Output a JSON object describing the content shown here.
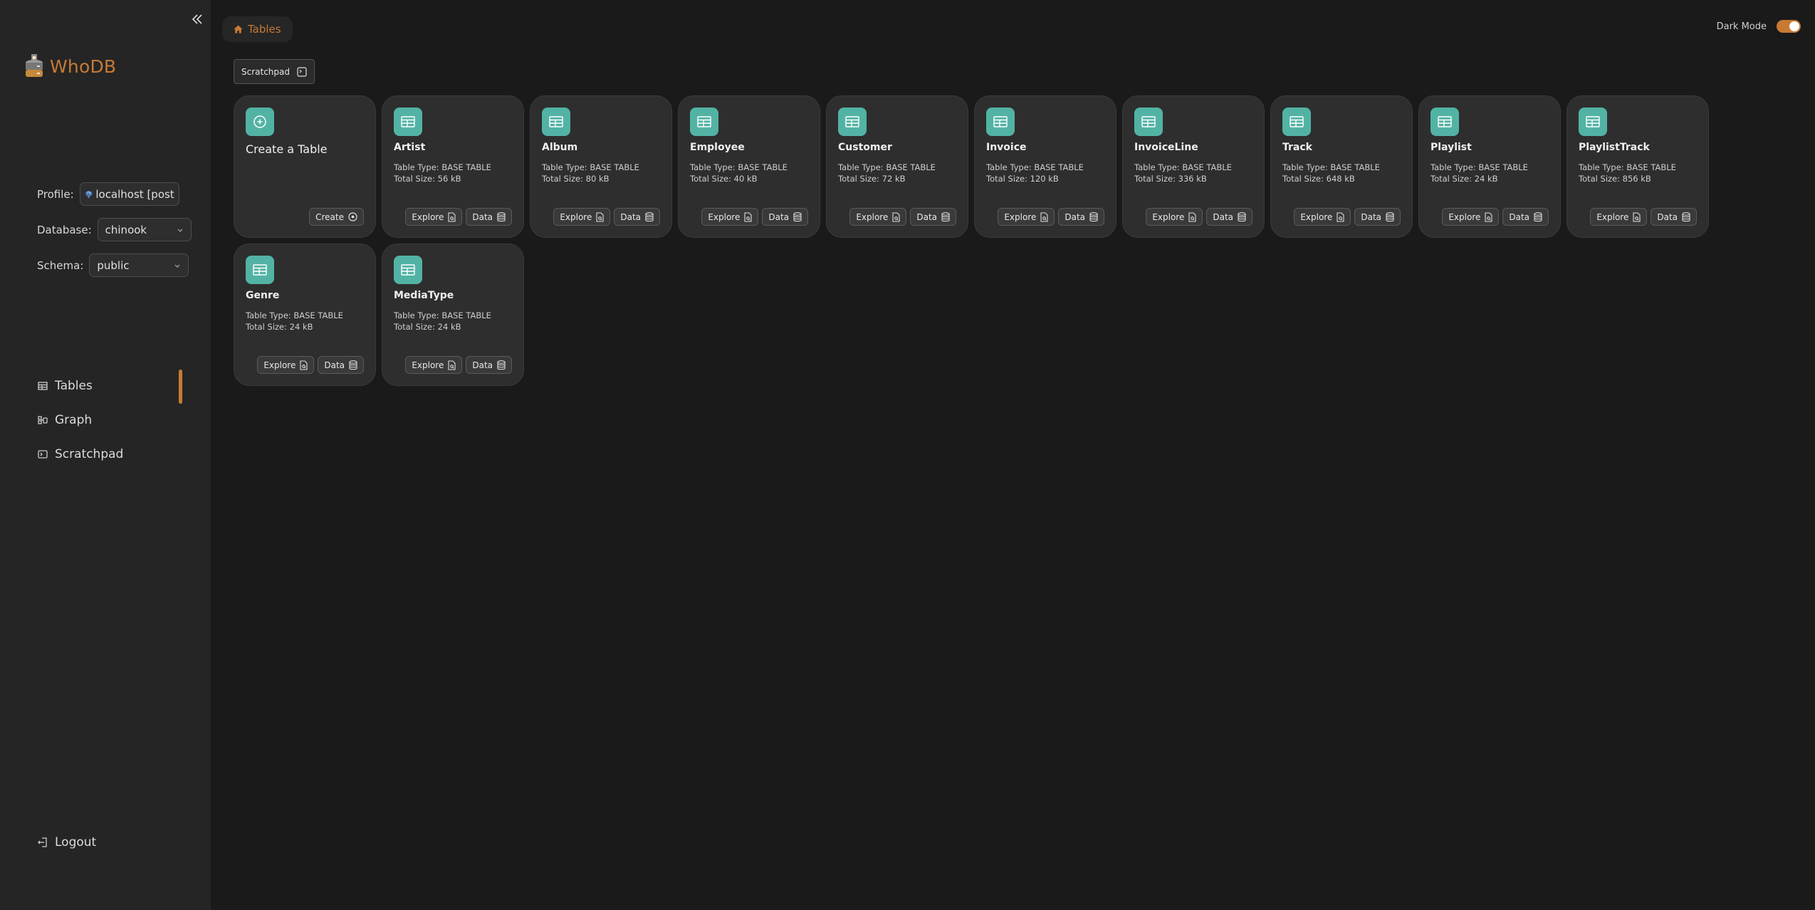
{
  "app": {
    "name": "WhoDB",
    "accent": "#c87a34",
    "tile_color": "#52b3a4"
  },
  "sidebar": {
    "profile": {
      "label": "Profile:",
      "value": "localhost [post"
    },
    "database": {
      "label": "Database:",
      "value": "chinook"
    },
    "schema": {
      "label": "Schema:",
      "value": "public"
    },
    "nav": [
      {
        "label": "Tables",
        "icon": "table-icon",
        "active": true
      },
      {
        "label": "Graph",
        "icon": "graph-icon",
        "active": false
      },
      {
        "label": "Scratchpad",
        "icon": "terminal-icon",
        "active": false
      }
    ],
    "logout_label": "Logout"
  },
  "header": {
    "breadcrumb": "Tables",
    "dark_mode_label": "Dark Mode",
    "dark_mode_on": true,
    "scratchpad_label": "Scratchpad"
  },
  "create_card": {
    "title": "Create a Table",
    "button_label": "Create"
  },
  "tables": [
    {
      "name": "Artist",
      "type": "Table Type: BASE TABLE",
      "size": "Total Size: 56 kB"
    },
    {
      "name": "Album",
      "type": "Table Type: BASE TABLE",
      "size": "Total Size: 80 kB"
    },
    {
      "name": "Employee",
      "type": "Table Type: BASE TABLE",
      "size": "Total Size: 40 kB"
    },
    {
      "name": "Customer",
      "type": "Table Type: BASE TABLE",
      "size": "Total Size: 72 kB"
    },
    {
      "name": "Invoice",
      "type": "Table Type: BASE TABLE",
      "size": "Total Size: 120 kB"
    },
    {
      "name": "InvoiceLine",
      "type": "Table Type: BASE TABLE",
      "size": "Total Size: 336 kB"
    },
    {
      "name": "Track",
      "type": "Table Type: BASE TABLE",
      "size": "Total Size: 648 kB"
    },
    {
      "name": "Playlist",
      "type": "Table Type: BASE TABLE",
      "size": "Total Size: 24 kB"
    },
    {
      "name": "PlaylistTrack",
      "type": "Table Type: BASE TABLE",
      "size": "Total Size: 856 kB"
    },
    {
      "name": "Genre",
      "type": "Table Type: BASE TABLE",
      "size": "Total Size: 24 kB"
    },
    {
      "name": "MediaType",
      "type": "Table Type: BASE TABLE",
      "size": "Total Size: 24 kB"
    }
  ],
  "card_buttons": {
    "explore": "Explore",
    "data": "Data"
  }
}
